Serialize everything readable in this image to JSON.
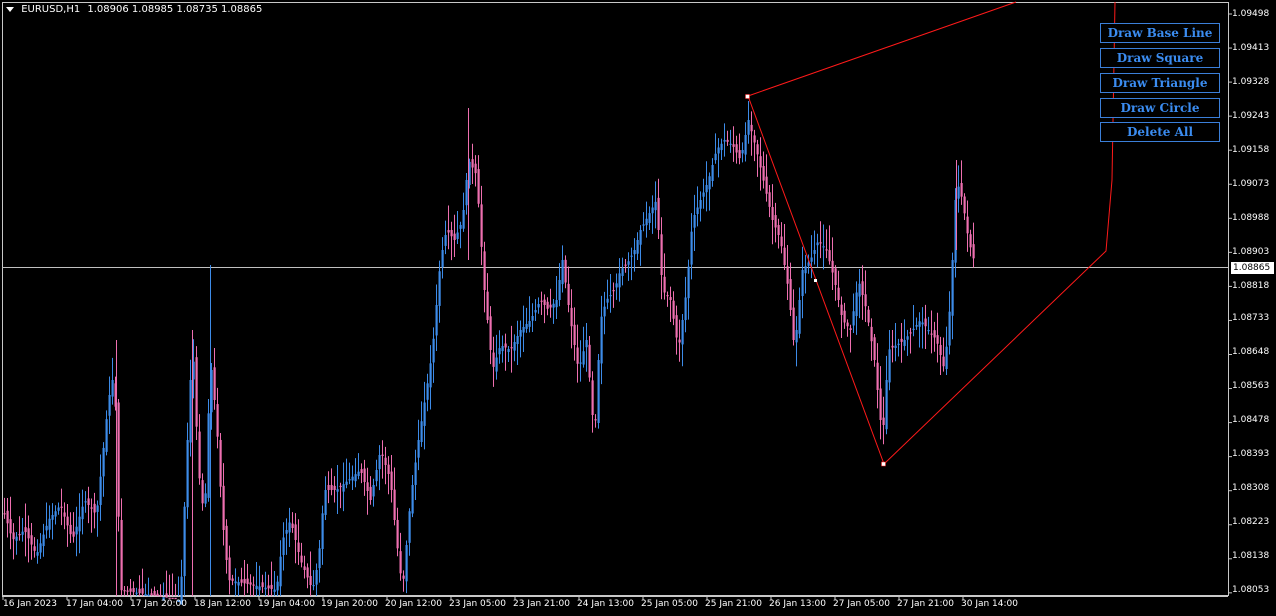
{
  "symbol": {
    "name": "EURUSD,H1",
    "ohlc": "1.08906 1.08985 1.08735 1.08865"
  },
  "buttons": [
    {
      "label": "Draw Base Line"
    },
    {
      "label": "Draw Square"
    },
    {
      "label": "Draw Triangle"
    },
    {
      "label": "Draw Circle"
    },
    {
      "label": "Delete All"
    }
  ],
  "price_axis": [
    "1.09498",
    "1.09413",
    "1.09328",
    "1.09243",
    "1.09158",
    "1.09073",
    "1.08988",
    "1.08903",
    "1.08818",
    "1.08733",
    "1.08648",
    "1.08563",
    "1.08478",
    "1.08393",
    "1.08308",
    "1.08223",
    "1.08138",
    "1.08053"
  ],
  "current_price": "1.08865",
  "time_axis": [
    "16 Jan 2023",
    "17 Jan 04:00",
    "17 Jan 20:00",
    "18 Jan 12:00",
    "19 Jan 04:00",
    "19 Jan 20:00",
    "20 Jan 12:00",
    "23 Jan 05:00",
    "23 Jan 21:00",
    "24 Jan 13:00",
    "25 Jan 05:00",
    "25 Jan 21:00",
    "26 Jan 13:00",
    "27 Jan 05:00",
    "27 Jan 21:00",
    "30 Jan 14:00"
  ],
  "colors": {
    "background": "#000000",
    "bull": "#3d8be8",
    "bear": "#ee6fb0",
    "drawing": "#ff1a1a",
    "button_text": "#3b8cf0",
    "grid_line": "#c0c0c0"
  }
}
